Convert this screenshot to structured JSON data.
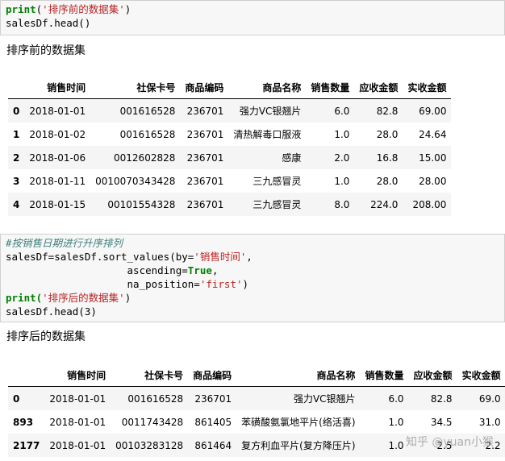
{
  "cell1": {
    "line1_fn": "print(",
    "line1_str": "'排序前的数据集'",
    "line1_end": ")",
    "line2": "salesDf.head()"
  },
  "output1_label": "排序前的数据集",
  "table1": {
    "headers": [
      "",
      "销售时间",
      "社保卡号",
      "商品编码",
      "商品名称",
      "销售数量",
      "应收金额",
      "实收金额"
    ],
    "rows": [
      [
        "0",
        "2018-01-01",
        "001616528",
        "236701",
        "强力VC银翘片",
        "6.0",
        "82.8",
        "69.00"
      ],
      [
        "1",
        "2018-01-02",
        "001616528",
        "236701",
        "清热解毒口服液",
        "1.0",
        "28.0",
        "24.64"
      ],
      [
        "2",
        "2018-01-06",
        "0012602828",
        "236701",
        "感康",
        "2.0",
        "16.8",
        "15.00"
      ],
      [
        "3",
        "2018-01-11",
        "0010070343428",
        "236701",
        "三九感冒灵",
        "1.0",
        "28.0",
        "28.00"
      ],
      [
        "4",
        "2018-01-15",
        "00101554328",
        "236701",
        "三九感冒灵",
        "8.0",
        "224.0",
        "208.00"
      ]
    ]
  },
  "cell2": {
    "comment": "#按销售日期进行升序排列",
    "l2a": "salesDf=salesDf.sort_values(by=",
    "l2s": "'销售时间'",
    "l2b": ",",
    "l3a": "                    ascending=",
    "l3k": "True",
    "l3b": ",",
    "l4a": "                    na_position=",
    "l4s": "'first'",
    "l4b": ")",
    "l5a": "print(",
    "l5s": "'排序后的数据集'",
    "l5b": ")",
    "l6": "salesDf.head(3)"
  },
  "output2_label": "排序后的数据集",
  "table2": {
    "headers": [
      "",
      "销售时间",
      "社保卡号",
      "商品编码",
      "商品名称",
      "销售数量",
      "应收金额",
      "实收金额"
    ],
    "rows": [
      [
        "0",
        "2018-01-01",
        "001616528",
        "236701",
        "强力VC银翘片",
        "6.0",
        "82.8",
        "69.0"
      ],
      [
        "893",
        "2018-01-01",
        "0011743428",
        "861405",
        "苯磺酸氨氯地平片(络活喜)",
        "1.0",
        "34.5",
        "31.0"
      ],
      [
        "2177",
        "2018-01-01",
        "00103283128",
        "861464",
        "复方利血平片(复方降压片)",
        "1.0",
        "2.5",
        "2.2"
      ]
    ]
  },
  "watermark": "知乎 @yuan小猴"
}
